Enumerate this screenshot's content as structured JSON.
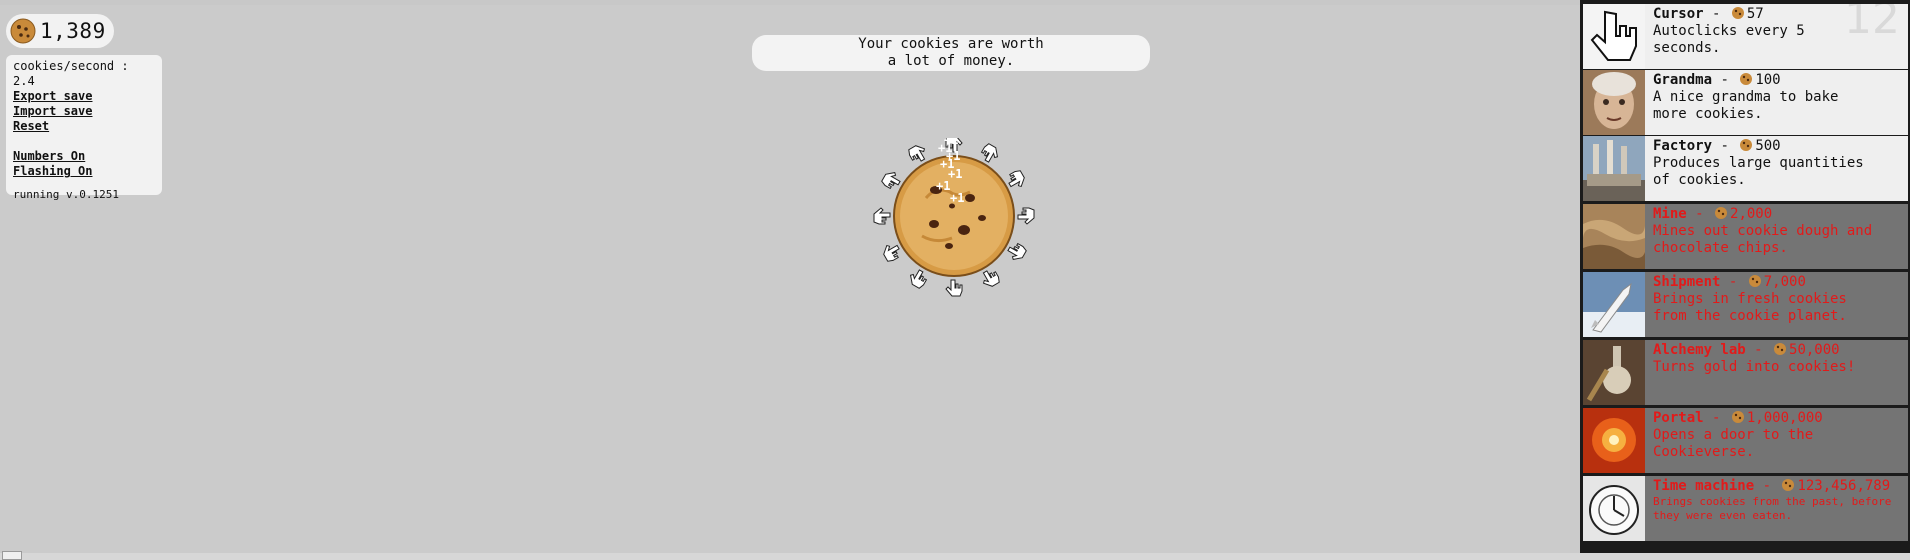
{
  "cookies": {
    "count": "1,389"
  },
  "stats": {
    "rate": "cookies/second : 2.4",
    "export": "Export save",
    "import": "Import save",
    "reset": "Reset",
    "numbers": "Numbers On",
    "flashing": "Flashing On",
    "version": "running v.0.1251"
  },
  "banner": {
    "line1": "Your cookies are worth",
    "line2": "a lot of money."
  },
  "colors": {
    "affordable": "#111111",
    "unaffordable": "#e21a1a",
    "owned_count": "#d9d9d9"
  },
  "store": {
    "items": [
      {
        "name": "Cursor",
        "sep": " - ",
        "price": "57",
        "desc": [
          "Autoclicks every 5",
          "seconds."
        ],
        "owned": "12",
        "affordable": true,
        "icon": "cursor-hand-icon"
      },
      {
        "name": "Grandma",
        "sep": " - ",
        "price": "100",
        "desc": [
          "A nice grandma to bake",
          "more cookies."
        ],
        "affordable": true,
        "icon": "grandma-icon"
      },
      {
        "name": "Factory",
        "sep": " - ",
        "price": "500",
        "desc": [
          "Produces large quantities",
          "of cookies."
        ],
        "affordable": true,
        "icon": "factory-icon"
      },
      {
        "name": "Mine",
        "sep": " - ",
        "price": "2,000",
        "desc": [
          "Mines out cookie dough and",
          "chocolate chips."
        ],
        "affordable": false,
        "icon": "mine-icon"
      },
      {
        "name": "Shipment",
        "sep": " - ",
        "price": "7,000",
        "desc": [
          "Brings in fresh cookies",
          "from the cookie planet."
        ],
        "affordable": false,
        "icon": "shuttle-icon"
      },
      {
        "name": "Alchemy lab",
        "sep": " - ",
        "price": "50,000",
        "desc": [
          "Turns gold into cookies!",
          ""
        ],
        "affordable": false,
        "icon": "alchemy-icon"
      },
      {
        "name": "Portal",
        "sep": " - ",
        "price": "1,000,000",
        "desc": [
          "Opens a door to the",
          "Cookieverse."
        ],
        "affordable": false,
        "icon": "portal-icon"
      },
      {
        "name": "Time machine",
        "sep": " - ",
        "price": "123,456,789",
        "desc": [
          "Brings cookies from the past, before",
          "they were even eaten."
        ],
        "affordable": false,
        "small": true,
        "icon": "clock-icon"
      }
    ]
  }
}
